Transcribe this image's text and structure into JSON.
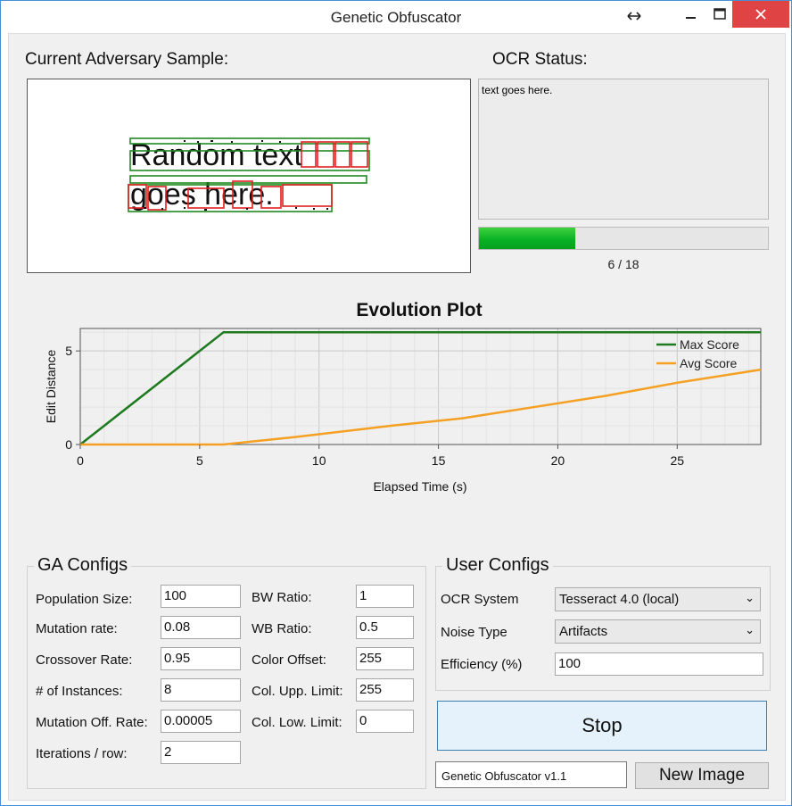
{
  "window": {
    "title": "Genetic Obfuscator",
    "controls": [
      "resize-icon",
      "minimize-icon",
      "maximize-icon",
      "close-icon"
    ]
  },
  "sample": {
    "label": "Current Adversary Sample:",
    "line1": "Random text",
    "line2": "goes here."
  },
  "ocr": {
    "label": "OCR Status:",
    "text": "text goes here.",
    "progress_value": 6,
    "progress_max": 18,
    "progress_text": "6 / 18"
  },
  "chart_data": {
    "type": "line",
    "title": "Evolution Plot",
    "xlabel": "Elapsed Time (s)",
    "ylabel": "Edit Distance",
    "xlim": [
      0,
      28.5
    ],
    "ylim": [
      0,
      6.2
    ],
    "xticks": [
      0,
      5,
      10,
      15,
      20,
      25
    ],
    "yticks": [
      0,
      5
    ],
    "grid": true,
    "legend": "top-right",
    "series": [
      {
        "name": "Max Score",
        "color": "#1e7a1e",
        "x": [
          0,
          6,
          28.5
        ],
        "y": [
          0,
          6,
          6
        ]
      },
      {
        "name": "Avg Score",
        "color": "#f5a023",
        "x": [
          0,
          6,
          9,
          13,
          16,
          19,
          22,
          25,
          28.5
        ],
        "y": [
          0,
          0,
          0.4,
          1.0,
          1.4,
          2.0,
          2.6,
          3.3,
          4.0
        ]
      }
    ]
  },
  "ga_configs": {
    "title": "GA Configs",
    "fields": [
      {
        "label": "Population Size:",
        "value": "100"
      },
      {
        "label": "Mutation rate:",
        "value": "0.08"
      },
      {
        "label": "Crossover Rate:",
        "value": "0.95"
      },
      {
        "label": "# of Instances:",
        "value": "8"
      },
      {
        "label": "Mutation Off. Rate:",
        "value": "0.00005"
      },
      {
        "label": "Iterations / row:",
        "value": "2"
      },
      {
        "label": "BW Ratio:",
        "value": "1"
      },
      {
        "label": "WB Ratio:",
        "value": "0.5"
      },
      {
        "label": "Color Offset:",
        "value": "255"
      },
      {
        "label": "Col. Upp. Limit:",
        "value": "255"
      },
      {
        "label": "Col. Low. Limit:",
        "value": "0"
      }
    ]
  },
  "user_configs": {
    "title": "User Configs",
    "ocr_system_label": "OCR System",
    "ocr_system_value": "Tesseract 4.0 (local)",
    "noise_type_label": "Noise Type",
    "noise_type_value": "Artifacts",
    "efficiency_label": "Efficiency (%)",
    "efficiency_value": "100"
  },
  "actions": {
    "stop_label": "Stop",
    "version_text": "Genetic Obfuscator v1.1",
    "new_image_label": "New Image"
  }
}
